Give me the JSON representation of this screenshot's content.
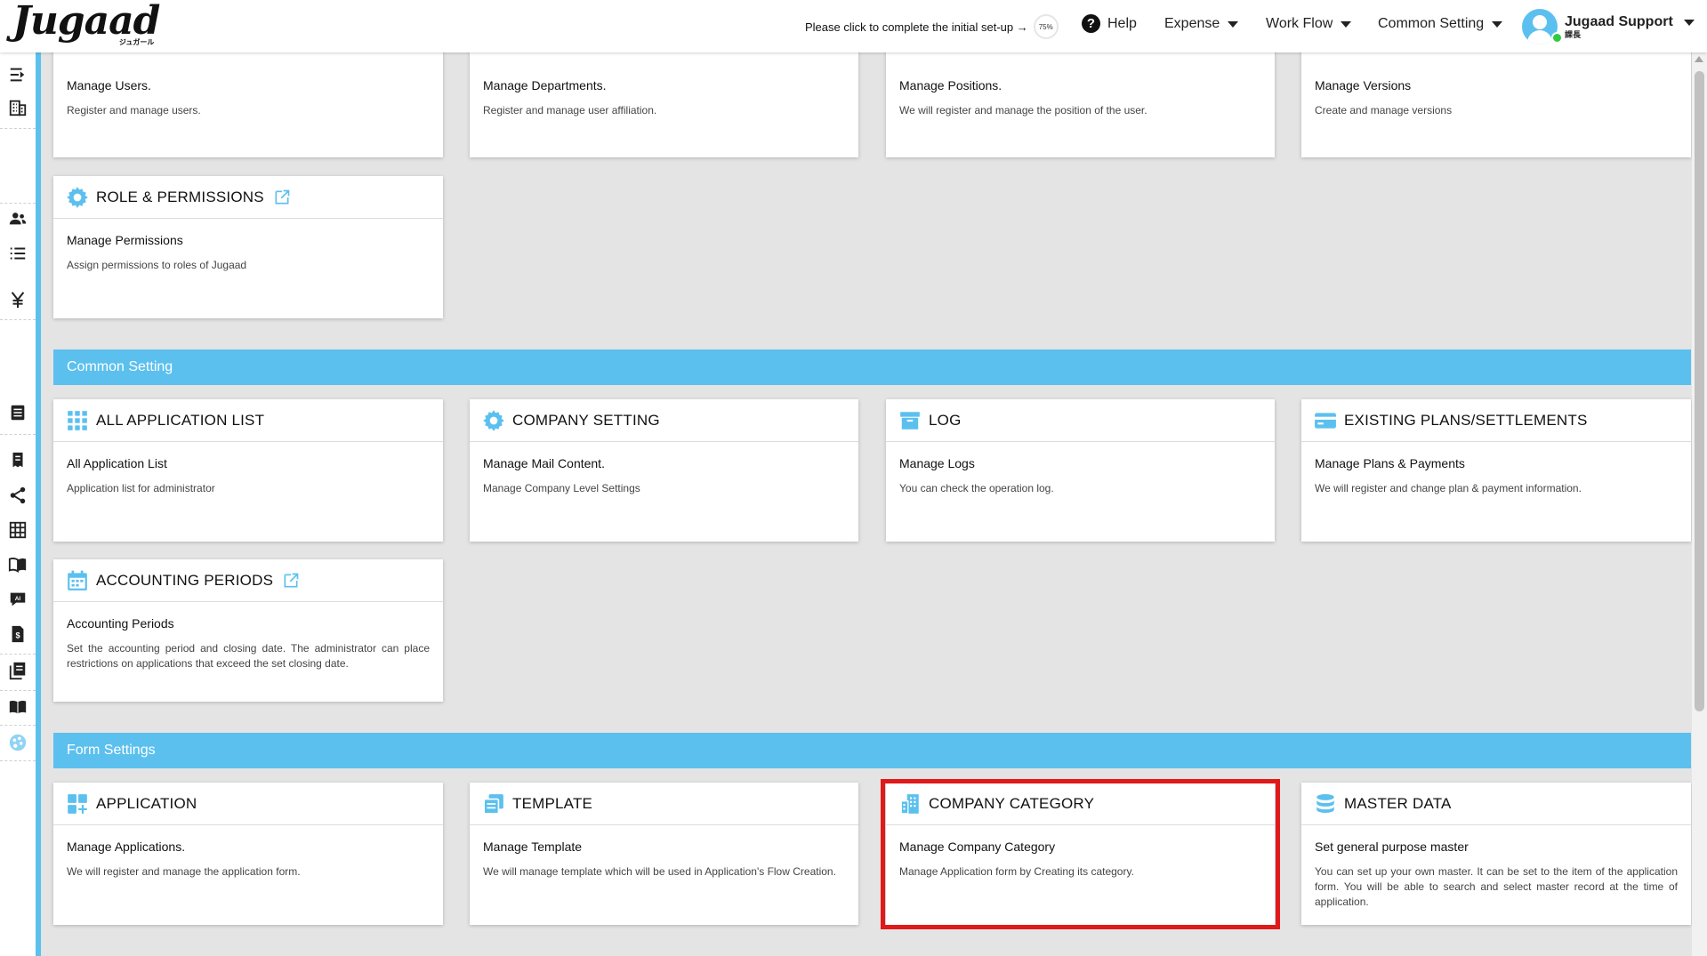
{
  "header": {
    "logo_text": "Jugaad",
    "logo_sub": "ジュガール",
    "setup_text": "Please click to complete the initial set-up →",
    "setup_progress": "75%",
    "help_label": "Help",
    "menus": [
      "Expense",
      "Work Flow",
      "Common Setting"
    ],
    "user_name": "Jugaad Support",
    "user_role": "課長"
  },
  "sidebar": {
    "icons": [
      "indent-icon",
      "building-icon",
      "users-icon",
      "list-icon",
      "yen-icon",
      "document-icon",
      "receipt-icon",
      "share-icon",
      "table-icon",
      "book-icon",
      "ai-chat-icon",
      "invoice-icon",
      "library-icon",
      "manual-icon",
      "palette-icon"
    ]
  },
  "sections": {
    "common": "Common Setting",
    "form": "Form Settings"
  },
  "cards": {
    "users": {
      "sub": "Manage Users.",
      "desc": "Register and manage users."
    },
    "departments": {
      "sub": "Manage Departments.",
      "desc": "Register and manage user affiliation."
    },
    "positions": {
      "sub": "Manage Positions.",
      "desc": "We will register and manage the position of the user."
    },
    "versions": {
      "sub": "Manage Versions",
      "desc": "Create and manage versions"
    },
    "roles": {
      "title": "ROLE & PERMISSIONS",
      "sub": "Manage Permissions",
      "desc": "Assign permissions to roles of Jugaad"
    },
    "all_apps": {
      "title": "ALL APPLICATION LIST",
      "sub": "All Application List",
      "desc": "Application list for administrator"
    },
    "company_setting": {
      "title": "COMPANY SETTING",
      "sub": "Manage Mail Content.",
      "desc": "Manage Company Level Settings"
    },
    "log": {
      "title": "LOG",
      "sub": "Manage Logs",
      "desc": "You can check the operation log."
    },
    "plans": {
      "title": "EXISTING PLANS/SETTLEMENTS",
      "sub": "Manage Plans & Payments",
      "desc": "We will register and change plan & payment information."
    },
    "accounting": {
      "title": "ACCOUNTING PERIODS",
      "sub": "Accounting Periods",
      "desc": "Set the accounting period and closing date. The administrator can place restrictions on applications that exceed the set closing date."
    },
    "application": {
      "title": "APPLICATION",
      "sub": "Manage Applications.",
      "desc": "We will register and manage the application form."
    },
    "template": {
      "title": "TEMPLATE",
      "sub": "Manage Template",
      "desc": "We will manage template which will be used in Application's Flow Creation."
    },
    "company_category": {
      "title": "COMPANY CATEGORY",
      "sub": "Manage Company Category",
      "desc": "Manage Application form by Creating its category."
    },
    "master_data": {
      "title": "MASTER DATA",
      "sub": "Set general purpose master",
      "desc": "You can set up your own master. It can be set to the item of the application form. You will be able to search and select master record at the time of application."
    }
  },
  "colors": {
    "accent": "#5bc0ee",
    "highlight": "#e01a1a"
  }
}
